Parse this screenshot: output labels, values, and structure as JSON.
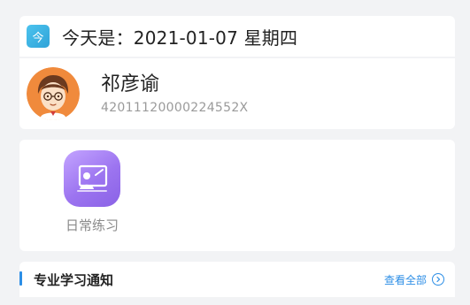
{
  "header": {
    "today_icon_char": "今",
    "date_text": "今天是：2021-01-07 星期四"
  },
  "profile": {
    "name": "祁彦谕",
    "id_number": "42011120000224552X"
  },
  "apps": [
    {
      "label": "日常练习",
      "icon": "blackboard-teacher-icon"
    }
  ],
  "notice": {
    "title": "专业学习通知",
    "view_all_label": "查看全部"
  },
  "colors": {
    "accent": "#2c8ee6",
    "today_icon": "#3fb6e6",
    "app_icon": "#a07af2",
    "background": "#f2f3f5"
  }
}
